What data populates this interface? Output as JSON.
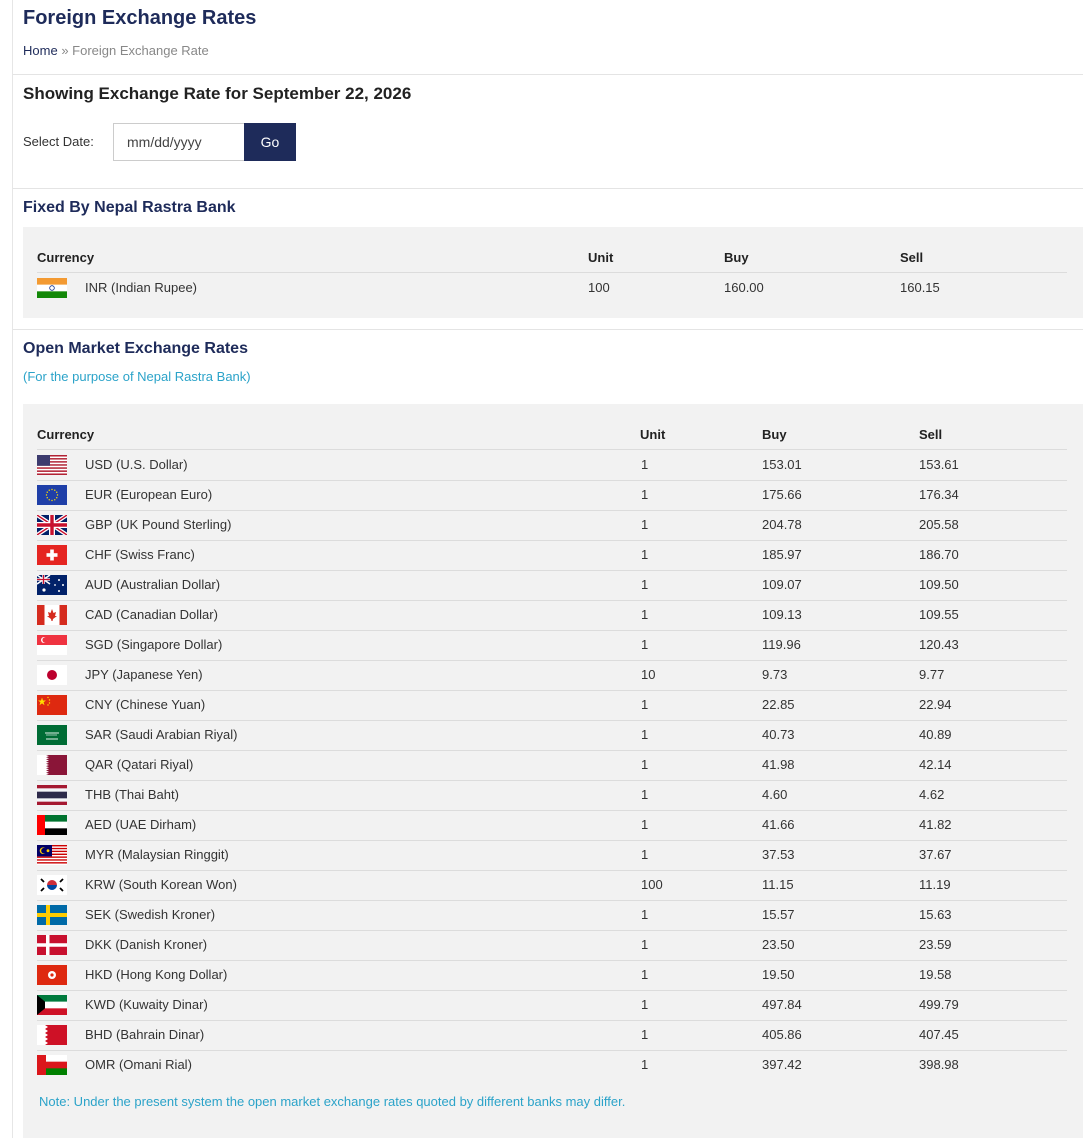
{
  "page": {
    "title": "Foreign Exchange Rates",
    "breadcrumb_home": "Home",
    "breadcrumb_sep": "»",
    "breadcrumb_current": "Foreign Exchange Rate"
  },
  "date_section": {
    "heading": "Showing Exchange Rate for September 22, 2026",
    "select_label": "Select Date:",
    "input_placeholder": "mm/dd/yyyy",
    "go_label": "Go"
  },
  "fixed": {
    "heading": "Fixed By Nepal Rastra Bank",
    "columns": {
      "currency": "Currency",
      "unit": "Unit",
      "buy": "Buy",
      "sell": "Sell"
    },
    "rows": [
      {
        "flag": "in-flag-icon",
        "currency": "INR (Indian Rupee)",
        "unit": "100",
        "buy": "160.00",
        "sell": "160.15"
      }
    ]
  },
  "open": {
    "heading": "Open Market Exchange Rates",
    "subheading": "(For the purpose of Nepal Rastra Bank)",
    "columns": {
      "currency": "Currency",
      "unit": "Unit",
      "buy": "Buy",
      "sell": "Sell"
    },
    "rows": [
      {
        "flag": "us-flag-icon",
        "currency": "USD (U.S. Dollar)",
        "unit": "1",
        "buy": "153.01",
        "sell": "153.61"
      },
      {
        "flag": "eu-flag-icon",
        "currency": "EUR (European Euro)",
        "unit": "1",
        "buy": "175.66",
        "sell": "176.34"
      },
      {
        "flag": "gb-flag-icon",
        "currency": "GBP (UK Pound Sterling)",
        "unit": "1",
        "buy": "204.78",
        "sell": "205.58"
      },
      {
        "flag": "ch-flag-icon",
        "currency": "CHF (Swiss Franc)",
        "unit": "1",
        "buy": "185.97",
        "sell": "186.70"
      },
      {
        "flag": "au-flag-icon",
        "currency": "AUD (Australian Dollar)",
        "unit": "1",
        "buy": "109.07",
        "sell": "109.50"
      },
      {
        "flag": "ca-flag-icon",
        "currency": "CAD (Canadian Dollar)",
        "unit": "1",
        "buy": "109.13",
        "sell": "109.55"
      },
      {
        "flag": "sg-flag-icon",
        "currency": "SGD (Singapore Dollar)",
        "unit": "1",
        "buy": "119.96",
        "sell": "120.43"
      },
      {
        "flag": "jp-flag-icon",
        "currency": "JPY (Japanese Yen)",
        "unit": "10",
        "buy": "9.73",
        "sell": "9.77"
      },
      {
        "flag": "cn-flag-icon",
        "currency": "CNY (Chinese Yuan)",
        "unit": "1",
        "buy": "22.85",
        "sell": "22.94"
      },
      {
        "flag": "sa-flag-icon",
        "currency": "SAR (Saudi Arabian Riyal)",
        "unit": "1",
        "buy": "40.73",
        "sell": "40.89"
      },
      {
        "flag": "qa-flag-icon",
        "currency": "QAR (Qatari Riyal)",
        "unit": "1",
        "buy": "41.98",
        "sell": "42.14"
      },
      {
        "flag": "th-flag-icon",
        "currency": "THB (Thai Baht)",
        "unit": "1",
        "buy": "4.60",
        "sell": "4.62"
      },
      {
        "flag": "ae-flag-icon",
        "currency": "AED (UAE Dirham)",
        "unit": "1",
        "buy": "41.66",
        "sell": "41.82"
      },
      {
        "flag": "my-flag-icon",
        "currency": "MYR (Malaysian Ringgit)",
        "unit": "1",
        "buy": "37.53",
        "sell": "37.67"
      },
      {
        "flag": "kr-flag-icon",
        "currency": "KRW (South Korean Won)",
        "unit": "100",
        "buy": "11.15",
        "sell": "11.19"
      },
      {
        "flag": "se-flag-icon",
        "currency": "SEK (Swedish Kroner)",
        "unit": "1",
        "buy": "15.57",
        "sell": "15.63"
      },
      {
        "flag": "dk-flag-icon",
        "currency": "DKK (Danish Kroner)",
        "unit": "1",
        "buy": "23.50",
        "sell": "23.59"
      },
      {
        "flag": "hk-flag-icon",
        "currency": "HKD (Hong Kong Dollar)",
        "unit": "1",
        "buy": "19.50",
        "sell": "19.58"
      },
      {
        "flag": "kw-flag-icon",
        "currency": "KWD (Kuwaity Dinar)",
        "unit": "1",
        "buy": "497.84",
        "sell": "499.79"
      },
      {
        "flag": "bh-flag-icon",
        "currency": "BHD (Bahrain Dinar)",
        "unit": "1",
        "buy": "405.86",
        "sell": "407.45"
      },
      {
        "flag": "om-flag-icon",
        "currency": "OMR (Omani Rial)",
        "unit": "1",
        "buy": "397.42",
        "sell": "398.98"
      }
    ],
    "note": "Note: Under the present system the open market exchange rates quoted by different banks may differ."
  },
  "colors": {
    "brand_navy": "#1e2b5a",
    "accent_cyan": "#2ba3c9",
    "panel_gray": "#f2f2f2"
  }
}
